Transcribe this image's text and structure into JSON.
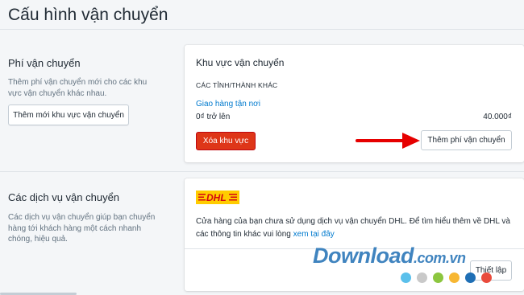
{
  "page": {
    "title": "Cấu hình vận chuyển"
  },
  "shipping_fees": {
    "heading": "Phí vận chuyển",
    "description": "Thêm phí vận chuyển mới cho các khu vực vận chuyển khác nhau.",
    "add_zone_button": "Thêm mới khu vực vận chuyển"
  },
  "zone_card": {
    "title": "Khu vực vận chuyển",
    "region": "CÁC TỈNH/THÀNH KHÁC",
    "rate_name": "Giao hàng tận nơi",
    "rate_condition": "0₫ trở lên",
    "rate_price": "40.000₫",
    "delete_button": "Xóa khu vực",
    "add_rate_button": "Thêm phí vận chuyển"
  },
  "carrier_services": {
    "heading": "Các dịch vụ vận chuyển",
    "description": "Các dịch vụ vận chuyển giúp bạn chuyển hàng tới khách hàng một cách nhanh chóng, hiệu quả."
  },
  "carrier_card": {
    "logo_text": "DHL",
    "note_text": "Cửa hàng của bạn chưa sử dụng dịch vụ vận chuyển DHL. Để tìm hiểu thêm về DHL và các thông tin khác vui lòng ",
    "note_link": "xem tại đây",
    "setup_button": "Thiết lập"
  },
  "watermark": {
    "text": "Download",
    "domain": ".com.vn"
  },
  "colors": {
    "accent_link": "#007ace",
    "danger": "#de3618",
    "arrow": "#e60000",
    "dhl_yellow": "#ffcc00",
    "dhl_red": "#d40511",
    "dots": [
      "#5bc0eb",
      "#c9c9c9",
      "#8cc63f",
      "#f7b733",
      "#1f6fb5",
      "#e94b3c"
    ]
  }
}
